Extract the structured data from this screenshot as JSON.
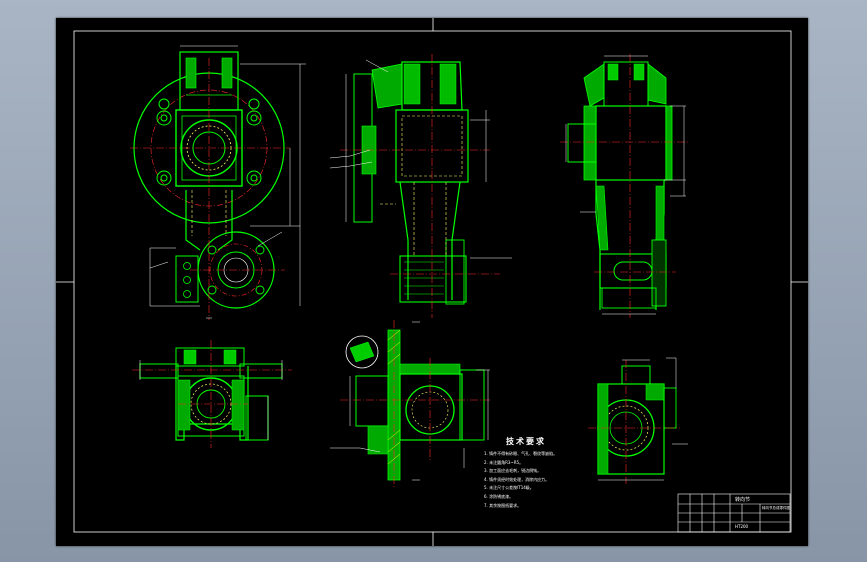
{
  "colors": {
    "background": "#8f9cae",
    "sheet": "#000000",
    "part": "#00ff00",
    "centerline": "#ff2a2a",
    "dimension": "#ffffff",
    "hatch": "#ffff00",
    "hidden": "#ffff66"
  },
  "notes": {
    "heading": "技术要求",
    "lines": [
      "1. 铸件不得有砂眼、气孔、裂纹等缺陷。",
      "2. 未注圆角R3~R5。",
      "3. 加工面应去毛刺，锐边倒钝。",
      "4. 铸件须经时效处理，消除内应力。",
      "5. 未注尺寸公差按IT14级。",
      "6. 涂防锈底漆。",
      "7. 其余按图纸要求。"
    ]
  },
  "title_block": {
    "drawing_name": "转向节",
    "part_label": "转向节总成零件图",
    "material": "HT200"
  }
}
